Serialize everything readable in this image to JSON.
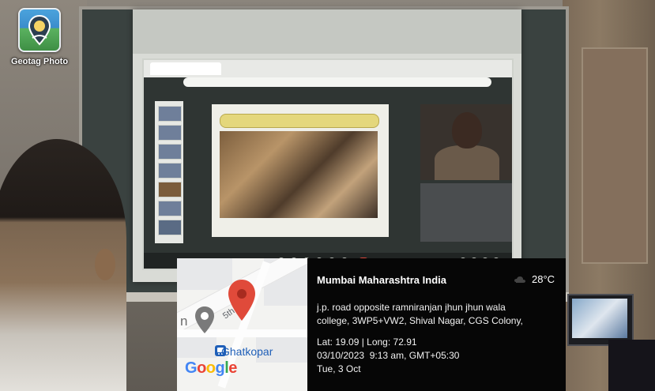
{
  "desktop_icon": {
    "label": "Geotag Photo"
  },
  "map": {
    "letter": "n",
    "street": "5th",
    "place": "Ghatkopar",
    "logo_letters": [
      "G",
      "o",
      "o",
      "g",
      "l",
      "e"
    ]
  },
  "stamp": {
    "location": "Mumbai Maharashtra India",
    "temperature": "28°C",
    "address_line1": "j.p. road opposite ramniranjan jhun jhun wala",
    "address_line2": "college, 3WP5+VW2, Shival Nagar, CGS Colony,",
    "coords": "Lat: 19.09 | Long: 72.91",
    "datetime": "03/10/2023  9:13 am, GMT+05:30",
    "day": "Tue, 3 Oct"
  },
  "colors": {
    "pin_red": "#E04A3A",
    "pin_gray": "#7a7a7a",
    "ghatkopar_blue": "#1f5fb8"
  },
  "icons": [
    "geotag-photo-app-icon",
    "red-location-pin-icon",
    "gray-location-pin-icon",
    "transit-station-icon",
    "weather-icon"
  ]
}
